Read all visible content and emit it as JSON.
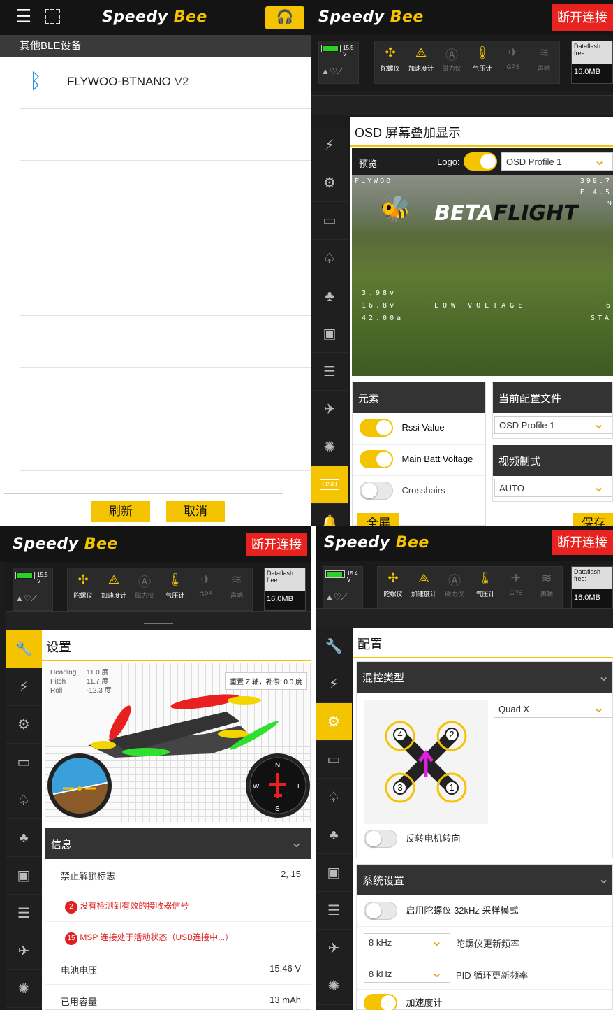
{
  "p1": {
    "title": "其他BLE设备",
    "device": "FLYWOO-BTNANO",
    "device_ver": "V2",
    "refresh": "刷新",
    "cancel": "取消"
  },
  "brand": {
    "a": "Speedy",
    "b": "Bee"
  },
  "disconnect": "断开连接",
  "sensors": [
    "陀螺仪",
    "加速度计",
    "磁力仪",
    "气压计",
    "GPS",
    "声呐"
  ],
  "df": {
    "label": "Dataflash free:",
    "value": "16.0MB"
  },
  "batt": {
    "p2": "15.5 V",
    "p3": "15.5 V",
    "p4": "15.4 V"
  },
  "p2": {
    "title": "OSD 屏幕叠加显示",
    "preview": "预览",
    "logo": "Logo:",
    "profile_sel": "OSD Profile 1",
    "osd": {
      "craft": "FLYWOO",
      "brand1": "BETA",
      "brand2": "FLIGHT",
      "v1": "3.98v",
      "v2": "16.8v",
      "a": "42.00a",
      "warn": "LOW VOLTAGE",
      "tr1": "399.7",
      "tr2": "E 4.5",
      "tr3": "9",
      "br1": "6",
      "br2": "STA"
    },
    "elements": "元素",
    "el": [
      "Rssi Value",
      "Main Batt Voltage",
      "Crosshairs"
    ],
    "cur_profile": "当前配置文件",
    "cur_profile_val": "OSD Profile 1",
    "video": "视频制式",
    "video_val": "AUTO",
    "fullscreen": "全屏",
    "save": "保存",
    "osd_tab": "OSD"
  },
  "p3": {
    "title": "设置",
    "heading_l": "Heading",
    "heading_v": "11.0 度",
    "pitch_l": "Pitch",
    "pitch_v": "11.7 度",
    "roll_l": "Roll",
    "roll_v": "-12.3 度",
    "reset": "重置 Z 轴，补偿: 0.0 度",
    "info": "信息",
    "arm_l": "禁止解锁标志",
    "arm_v": "2, 15",
    "err1_n": "2",
    "err1": "没有检测到有效的接收器信号",
    "err2_n": "15",
    "err2": "MSP 连接处于活动状态（USB连接中...）",
    "volt_l": "电池电压",
    "volt_v": "15.46 V",
    "cap_l": "已用容量",
    "cap_v": "13 mAh"
  },
  "p4": {
    "title": "配置",
    "mixer": "混控类型",
    "mixer_val": "Quad X",
    "motors": [
      "4",
      "2",
      "3",
      "1"
    ],
    "reverse": "反转电机转向",
    "sys": "系统设置",
    "gyro32": "启用陀螺仪 32kHz 采样模式",
    "gyro_rate": "8 kHz",
    "gyro_rate_l": "陀螺仪更新频率",
    "pid_rate": "8 kHz",
    "pid_rate_l": "PID 循环更新频率",
    "acc": "加速度计"
  }
}
